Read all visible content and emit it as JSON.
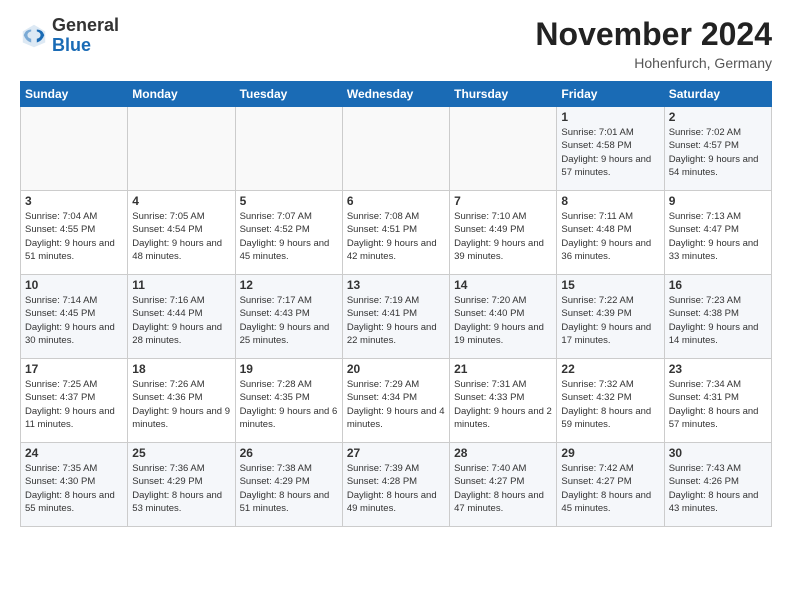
{
  "header": {
    "logo_general": "General",
    "logo_blue": "Blue",
    "month_title": "November 2024",
    "location": "Hohenfurch, Germany"
  },
  "days_of_week": [
    "Sunday",
    "Monday",
    "Tuesday",
    "Wednesday",
    "Thursday",
    "Friday",
    "Saturday"
  ],
  "weeks": [
    [
      {
        "day": "",
        "info": ""
      },
      {
        "day": "",
        "info": ""
      },
      {
        "day": "",
        "info": ""
      },
      {
        "day": "",
        "info": ""
      },
      {
        "day": "",
        "info": ""
      },
      {
        "day": "1",
        "info": "Sunrise: 7:01 AM\nSunset: 4:58 PM\nDaylight: 9 hours and 57 minutes."
      },
      {
        "day": "2",
        "info": "Sunrise: 7:02 AM\nSunset: 4:57 PM\nDaylight: 9 hours and 54 minutes."
      }
    ],
    [
      {
        "day": "3",
        "info": "Sunrise: 7:04 AM\nSunset: 4:55 PM\nDaylight: 9 hours and 51 minutes."
      },
      {
        "day": "4",
        "info": "Sunrise: 7:05 AM\nSunset: 4:54 PM\nDaylight: 9 hours and 48 minutes."
      },
      {
        "day": "5",
        "info": "Sunrise: 7:07 AM\nSunset: 4:52 PM\nDaylight: 9 hours and 45 minutes."
      },
      {
        "day": "6",
        "info": "Sunrise: 7:08 AM\nSunset: 4:51 PM\nDaylight: 9 hours and 42 minutes."
      },
      {
        "day": "7",
        "info": "Sunrise: 7:10 AM\nSunset: 4:49 PM\nDaylight: 9 hours and 39 minutes."
      },
      {
        "day": "8",
        "info": "Sunrise: 7:11 AM\nSunset: 4:48 PM\nDaylight: 9 hours and 36 minutes."
      },
      {
        "day": "9",
        "info": "Sunrise: 7:13 AM\nSunset: 4:47 PM\nDaylight: 9 hours and 33 minutes."
      }
    ],
    [
      {
        "day": "10",
        "info": "Sunrise: 7:14 AM\nSunset: 4:45 PM\nDaylight: 9 hours and 30 minutes."
      },
      {
        "day": "11",
        "info": "Sunrise: 7:16 AM\nSunset: 4:44 PM\nDaylight: 9 hours and 28 minutes."
      },
      {
        "day": "12",
        "info": "Sunrise: 7:17 AM\nSunset: 4:43 PM\nDaylight: 9 hours and 25 minutes."
      },
      {
        "day": "13",
        "info": "Sunrise: 7:19 AM\nSunset: 4:41 PM\nDaylight: 9 hours and 22 minutes."
      },
      {
        "day": "14",
        "info": "Sunrise: 7:20 AM\nSunset: 4:40 PM\nDaylight: 9 hours and 19 minutes."
      },
      {
        "day": "15",
        "info": "Sunrise: 7:22 AM\nSunset: 4:39 PM\nDaylight: 9 hours and 17 minutes."
      },
      {
        "day": "16",
        "info": "Sunrise: 7:23 AM\nSunset: 4:38 PM\nDaylight: 9 hours and 14 minutes."
      }
    ],
    [
      {
        "day": "17",
        "info": "Sunrise: 7:25 AM\nSunset: 4:37 PM\nDaylight: 9 hours and 11 minutes."
      },
      {
        "day": "18",
        "info": "Sunrise: 7:26 AM\nSunset: 4:36 PM\nDaylight: 9 hours and 9 minutes."
      },
      {
        "day": "19",
        "info": "Sunrise: 7:28 AM\nSunset: 4:35 PM\nDaylight: 9 hours and 6 minutes."
      },
      {
        "day": "20",
        "info": "Sunrise: 7:29 AM\nSunset: 4:34 PM\nDaylight: 9 hours and 4 minutes."
      },
      {
        "day": "21",
        "info": "Sunrise: 7:31 AM\nSunset: 4:33 PM\nDaylight: 9 hours and 2 minutes."
      },
      {
        "day": "22",
        "info": "Sunrise: 7:32 AM\nSunset: 4:32 PM\nDaylight: 8 hours and 59 minutes."
      },
      {
        "day": "23",
        "info": "Sunrise: 7:34 AM\nSunset: 4:31 PM\nDaylight: 8 hours and 57 minutes."
      }
    ],
    [
      {
        "day": "24",
        "info": "Sunrise: 7:35 AM\nSunset: 4:30 PM\nDaylight: 8 hours and 55 minutes."
      },
      {
        "day": "25",
        "info": "Sunrise: 7:36 AM\nSunset: 4:29 PM\nDaylight: 8 hours and 53 minutes."
      },
      {
        "day": "26",
        "info": "Sunrise: 7:38 AM\nSunset: 4:29 PM\nDaylight: 8 hours and 51 minutes."
      },
      {
        "day": "27",
        "info": "Sunrise: 7:39 AM\nSunset: 4:28 PM\nDaylight: 8 hours and 49 minutes."
      },
      {
        "day": "28",
        "info": "Sunrise: 7:40 AM\nSunset: 4:27 PM\nDaylight: 8 hours and 47 minutes."
      },
      {
        "day": "29",
        "info": "Sunrise: 7:42 AM\nSunset: 4:27 PM\nDaylight: 8 hours and 45 minutes."
      },
      {
        "day": "30",
        "info": "Sunrise: 7:43 AM\nSunset: 4:26 PM\nDaylight: 8 hours and 43 minutes."
      }
    ]
  ]
}
